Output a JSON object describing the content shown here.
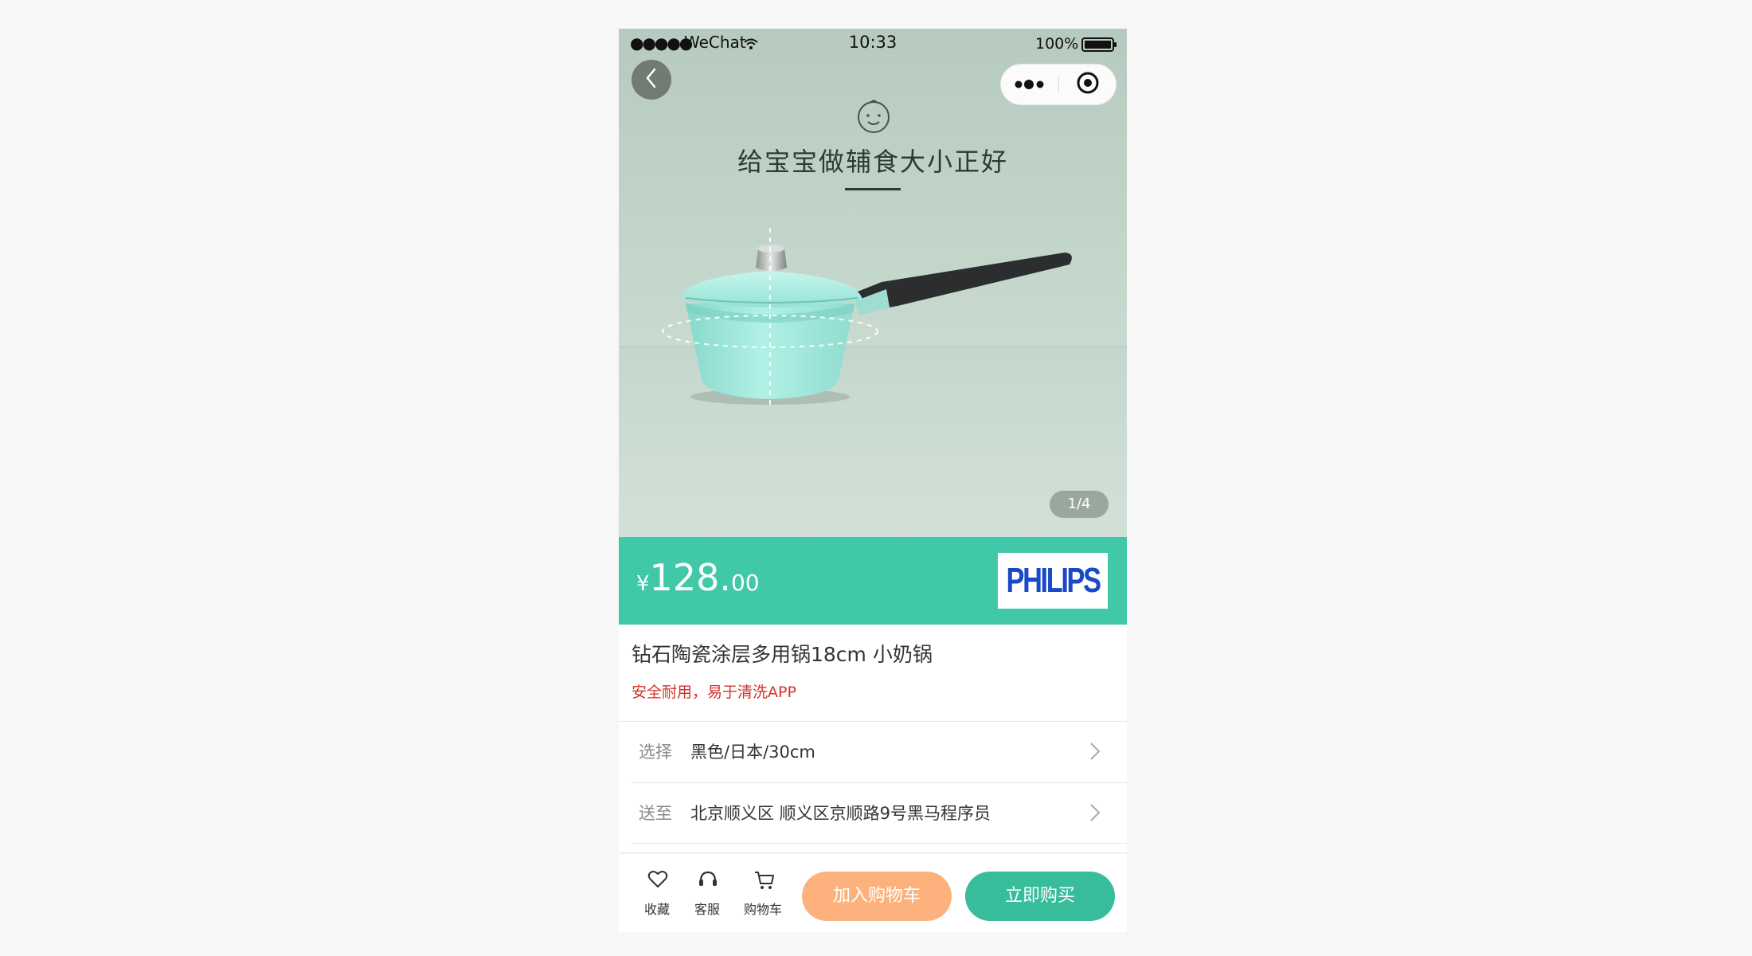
{
  "status_bar": {
    "signal": "●●●●●",
    "carrier": "WeChat",
    "time": "10:33",
    "battery": "100%"
  },
  "nav": {
    "back_icon": "chevron-left-icon",
    "more_icon": "more-dots-icon",
    "close_icon": "target-circle-icon"
  },
  "hero": {
    "caption": "给宝宝做辅食大小正好",
    "pager": "1/4",
    "colors": {
      "background": "#c3d6ca",
      "pot": "#a6ece0",
      "handle": "#2b2d2f"
    }
  },
  "price": {
    "currency": "¥",
    "integer": "128.",
    "decimal": "00",
    "bar_color": "#40c8a8"
  },
  "brand": {
    "logo_text": "PHILIPS",
    "logo_color": "#1948c8"
  },
  "product": {
    "title": "钻石陶瓷涂层多用锅18cm 小奶锅",
    "subtitle": "安全耐用，易于清洗APP"
  },
  "options": [
    {
      "label": "选择",
      "value": "黑色/日本/30cm"
    },
    {
      "label": "送至",
      "value": "北京顺义区 顺义区京顺路9号黑马程序员"
    }
  ],
  "bottom_bar": {
    "tabs": [
      {
        "label": "收藏",
        "icon": "heart-icon"
      },
      {
        "label": "客服",
        "icon": "headset-icon"
      },
      {
        "label": "购物车",
        "icon": "cart-icon"
      }
    ],
    "add_to_cart": "加入购物车",
    "buy_now": "立即购买",
    "colors": {
      "add_to_cart": "#fdb27d",
      "buy_now": "#37bc9c"
    }
  }
}
